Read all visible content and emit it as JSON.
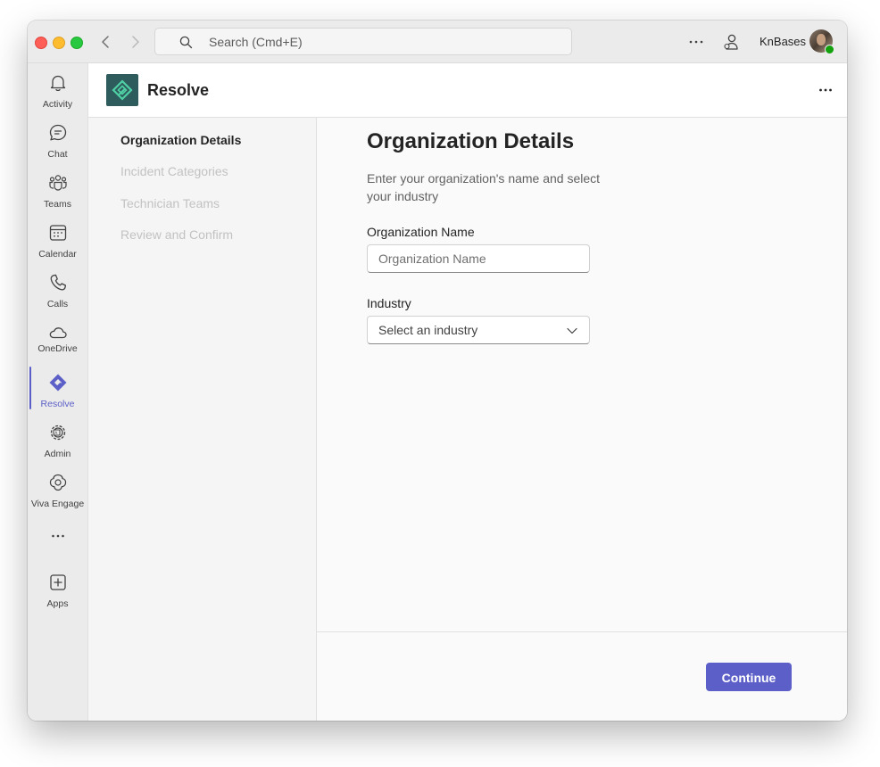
{
  "titlebar": {
    "search_placeholder": "Search (Cmd+E)",
    "account_name": "KnBases"
  },
  "rail": {
    "items": [
      {
        "label": "Activity",
        "icon": "bell-icon"
      },
      {
        "label": "Chat",
        "icon": "chat-icon"
      },
      {
        "label": "Teams",
        "icon": "teams-icon"
      },
      {
        "label": "Calendar",
        "icon": "calendar-icon"
      },
      {
        "label": "Calls",
        "icon": "phone-icon"
      },
      {
        "label": "OneDrive",
        "icon": "cloud-icon"
      },
      {
        "label": "Resolve",
        "icon": "resolve-icon",
        "active": true
      },
      {
        "label": "Admin",
        "icon": "admin-gear-icon"
      },
      {
        "label": "Viva Engage",
        "icon": "viva-engage-icon"
      },
      {
        "label": "Apps",
        "icon": "add-app-icon"
      }
    ]
  },
  "app": {
    "title": "Resolve"
  },
  "steps": [
    {
      "label": "Organization Details",
      "state": "current"
    },
    {
      "label": "Incident Categories",
      "state": "upcoming"
    },
    {
      "label": "Technician Teams",
      "state": "upcoming"
    },
    {
      "label": "Review and Confirm",
      "state": "upcoming"
    }
  ],
  "form": {
    "heading": "Organization Details",
    "description": "Enter your organization's name and select your industry",
    "org_name_label": "Organization Name",
    "org_name_placeholder": "Organization Name",
    "org_name_value": "",
    "industry_label": "Industry",
    "industry_placeholder": "Select an industry"
  },
  "footer": {
    "continue_label": "Continue"
  },
  "colors": {
    "accent": "#5b5fc7",
    "app_logo_bg": "#2e5b5c",
    "presence_available": "#13a10e"
  }
}
